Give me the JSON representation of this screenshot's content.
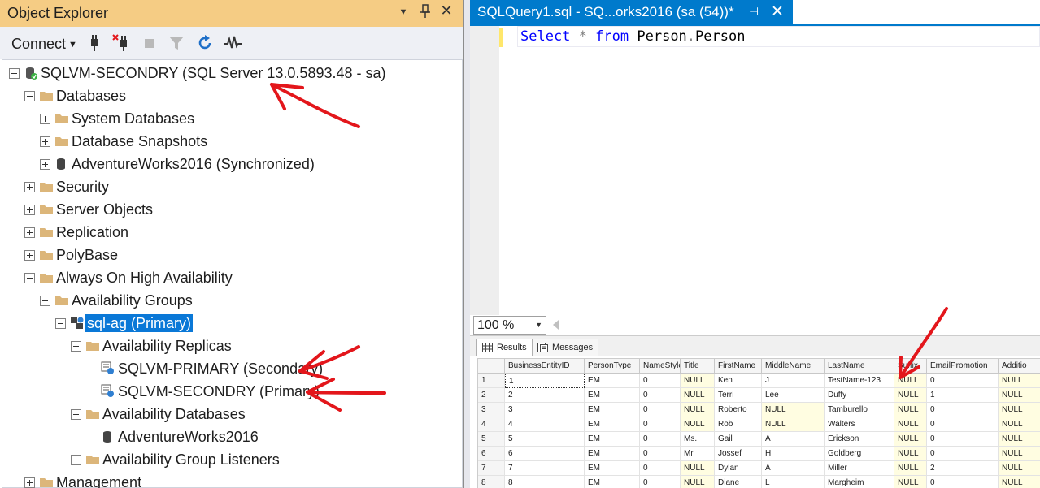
{
  "object_explorer": {
    "title": "Object Explorer",
    "connect_label": "Connect",
    "pin_glyph": "📌",
    "close_glyph": "✕",
    "dropdown_glyph": "▼",
    "toolbar_icons": [
      "connect-icon",
      "disconnect-icon",
      "stop-icon",
      "filter-icon",
      "refresh-icon",
      "activity-monitor-icon"
    ],
    "tree": [
      {
        "id": "server",
        "label": "SQLVM-SECONDRY (SQL Server 13.0.5893.48 - sa)",
        "icon": "server-icon",
        "expander": "minus"
      },
      {
        "id": "databases",
        "label": "Databases",
        "icon": "folder-icon",
        "expander": "minus"
      },
      {
        "id": "system-databases",
        "label": "System Databases",
        "icon": "folder-icon",
        "expander": "plus"
      },
      {
        "id": "database-snapshots",
        "label": "Database Snapshots",
        "icon": "folder-icon",
        "expander": "plus"
      },
      {
        "id": "adventureworks",
        "label": "AdventureWorks2016 (Synchronized)",
        "icon": "database-icon",
        "expander": "plus"
      },
      {
        "id": "security",
        "label": "Security",
        "icon": "folder-icon",
        "expander": "plus"
      },
      {
        "id": "server-objects",
        "label": "Server Objects",
        "icon": "folder-icon",
        "expander": "plus"
      },
      {
        "id": "replication",
        "label": "Replication",
        "icon": "folder-icon",
        "expander": "plus"
      },
      {
        "id": "polybase",
        "label": "PolyBase",
        "icon": "folder-icon",
        "expander": "plus"
      },
      {
        "id": "always-on",
        "label": "Always On High Availability",
        "icon": "folder-icon",
        "expander": "minus"
      },
      {
        "id": "availability-groups",
        "label": "Availability Groups",
        "icon": "folder-icon",
        "expander": "minus"
      },
      {
        "id": "sql-ag",
        "label": "sql-ag (Primary)",
        "icon": "availability-group-icon",
        "expander": "minus",
        "selected": true
      },
      {
        "id": "availability-replicas",
        "label": "Availability Replicas",
        "icon": "folder-icon",
        "expander": "minus"
      },
      {
        "id": "replica-primary",
        "label": "SQLVM-PRIMARY (Secondary)",
        "icon": "replica-icon",
        "expander": "none"
      },
      {
        "id": "replica-secondry",
        "label": "SQLVM-SECONDRY (Primary)",
        "icon": "replica-icon",
        "expander": "none"
      },
      {
        "id": "availability-databases",
        "label": "Availability Databases",
        "icon": "folder-icon",
        "expander": "minus"
      },
      {
        "id": "ag-adventureworks",
        "label": "AdventureWorks2016",
        "icon": "database-icon",
        "expander": "none"
      },
      {
        "id": "ag-listeners",
        "label": "Availability Group Listeners",
        "icon": "folder-icon",
        "expander": "plus"
      },
      {
        "id": "management",
        "label": "Management",
        "icon": "folder-icon",
        "expander": "plus"
      }
    ]
  },
  "query_tab": {
    "title": "SQLQuery1.sql - SQ...orks2016 (sa (54))*",
    "pin_glyph": "⊣",
    "close_glyph": "✕"
  },
  "editor": {
    "tokens": {
      "select": "Select",
      "star": "*",
      "from": "from",
      "schema": "Person",
      "dot": ".",
      "table": "Person"
    }
  },
  "zoom": {
    "value": "100 %"
  },
  "results_tabs": [
    {
      "label": "Results",
      "icon": "grid-icon",
      "active": true
    },
    {
      "label": "Messages",
      "icon": "messages-icon",
      "active": false
    }
  ],
  "results": {
    "columns": [
      "BusinessEntityID",
      "PersonType",
      "NameStyle",
      "Title",
      "FirstName",
      "MiddleName",
      "LastName",
      "Suffix",
      "EmailPromotion",
      "Additio"
    ],
    "rows": [
      [
        "1",
        "1",
        "EM",
        "0",
        "NULL",
        "Ken",
        "J",
        "TestName-123",
        "NULL",
        "0",
        "NULL"
      ],
      [
        "2",
        "2",
        "EM",
        "0",
        "NULL",
        "Terri",
        "Lee",
        "Duffy",
        "NULL",
        "1",
        "NULL"
      ],
      [
        "3",
        "3",
        "EM",
        "0",
        "NULL",
        "Roberto",
        "NULL",
        "Tamburello",
        "NULL",
        "0",
        "NULL"
      ],
      [
        "4",
        "4",
        "EM",
        "0",
        "NULL",
        "Rob",
        "NULL",
        "Walters",
        "NULL",
        "0",
        "NULL"
      ],
      [
        "5",
        "5",
        "EM",
        "0",
        "Ms.",
        "Gail",
        "A",
        "Erickson",
        "NULL",
        "0",
        "NULL"
      ],
      [
        "6",
        "6",
        "EM",
        "0",
        "Mr.",
        "Jossef",
        "H",
        "Goldberg",
        "NULL",
        "0",
        "NULL"
      ],
      [
        "7",
        "7",
        "EM",
        "0",
        "NULL",
        "Dylan",
        "A",
        "Miller",
        "NULL",
        "2",
        "NULL"
      ],
      [
        "8",
        "8",
        "EM",
        "0",
        "NULL",
        "Diane",
        "L",
        "Margheim",
        "NULL",
        "0",
        "NULL"
      ]
    ]
  },
  "colors": {
    "oe_title_bg": "#f5cc84",
    "tab_active": "#007acc",
    "selection": "#0a78d7",
    "annotation_red": "#e3161b",
    "null_cell": "#fffde1"
  }
}
